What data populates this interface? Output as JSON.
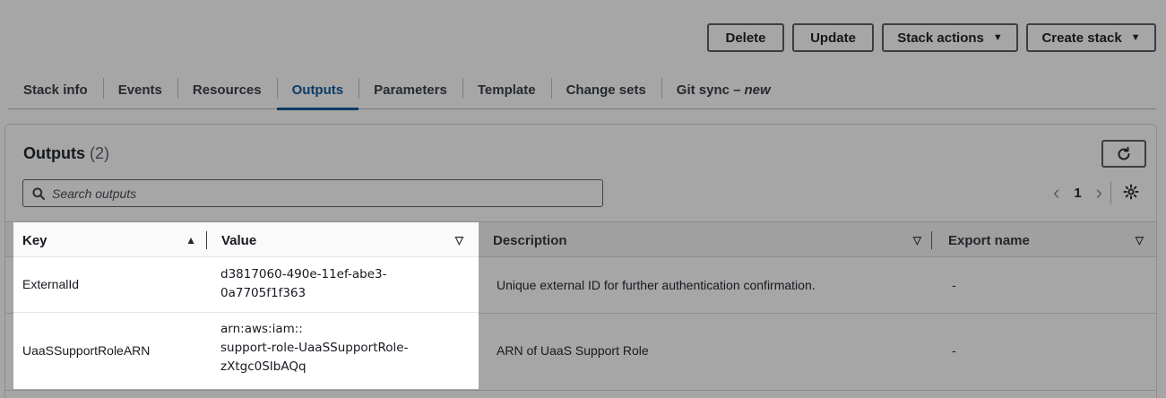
{
  "actions": {
    "delete": "Delete",
    "update": "Update",
    "stack_actions": "Stack actions",
    "create_stack": "Create stack"
  },
  "tabs": [
    {
      "label": "Stack info"
    },
    {
      "label": "Events"
    },
    {
      "label": "Resources"
    },
    {
      "label": "Outputs",
      "active": true
    },
    {
      "label": "Parameters"
    },
    {
      "label": "Template"
    },
    {
      "label": "Change sets"
    },
    {
      "label": "Git sync –",
      "badge": "new"
    }
  ],
  "outputs": {
    "title": "Outputs",
    "count": "(2)",
    "search_placeholder": "Search outputs",
    "page": "1",
    "columns": {
      "key": "Key",
      "value": "Value",
      "description": "Description",
      "export_name": "Export name"
    },
    "rows": [
      {
        "key": "ExternalId",
        "value_line1": "d3817060-490e-11ef-abe3-",
        "value_line2": "0a7705f1f363",
        "description": "Unique external ID for further authentication confirmation.",
        "export_name": "-"
      },
      {
        "key": "UaaSSupportRoleARN",
        "value_line1": "arn:aws:iam::",
        "value_line2": "support-role-UaaSSupportRole-",
        "value_line3": "zXtgc0SIbAQq",
        "description": "ARN of UaaS Support Role",
        "export_name": "-"
      }
    ]
  },
  "colors": {
    "overlay_bg": "#a6a6a6",
    "active_tab": "#0b3a68",
    "spotlight_bg": "#ffffff"
  }
}
